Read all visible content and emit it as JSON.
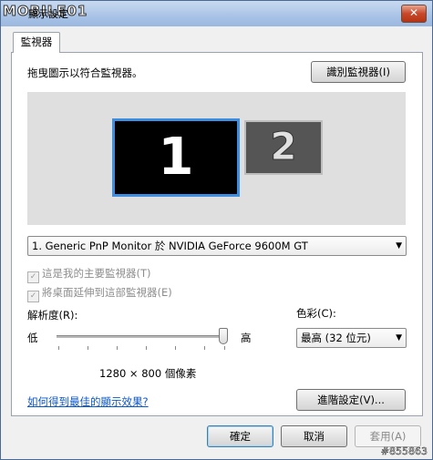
{
  "window": {
    "title": "顯示設定",
    "logo_text": "MOBILE01",
    "close_label": "✕",
    "watermark": "#855863"
  },
  "tabs": [
    {
      "label": "監視器",
      "active": true
    }
  ],
  "instruction": "拖曳圖示以符合監視器。",
  "identify_button": "識別監視器(I)",
  "monitors": [
    {
      "number": "1",
      "selected": true
    },
    {
      "number": "2",
      "selected": false
    }
  ],
  "monitor_select": {
    "value": "1. Generic PnP Monitor 於 NVIDIA GeForce 9600M GT"
  },
  "checkboxes": [
    {
      "label": "這是我的主要監視器(T)",
      "checked": true,
      "enabled": false
    },
    {
      "label": "將桌面延伸到這部監視器(E)",
      "checked": true,
      "enabled": false
    }
  ],
  "resolution": {
    "label": "解析度(R):",
    "low_label": "低",
    "high_label": "高",
    "value_text": "1280 × 800 個像素",
    "slider_level": 1.0
  },
  "color": {
    "label": "色彩(C):",
    "value": "最高 (32 位元)"
  },
  "help_link": "如何得到最佳的顯示效果?",
  "advanced_button": "進階設定(V)...",
  "footer": {
    "ok": "確定",
    "cancel": "取消",
    "apply": "套用(A)"
  },
  "colors": {
    "selection_border": "#3d8ee0",
    "link": "#0b57c8"
  }
}
